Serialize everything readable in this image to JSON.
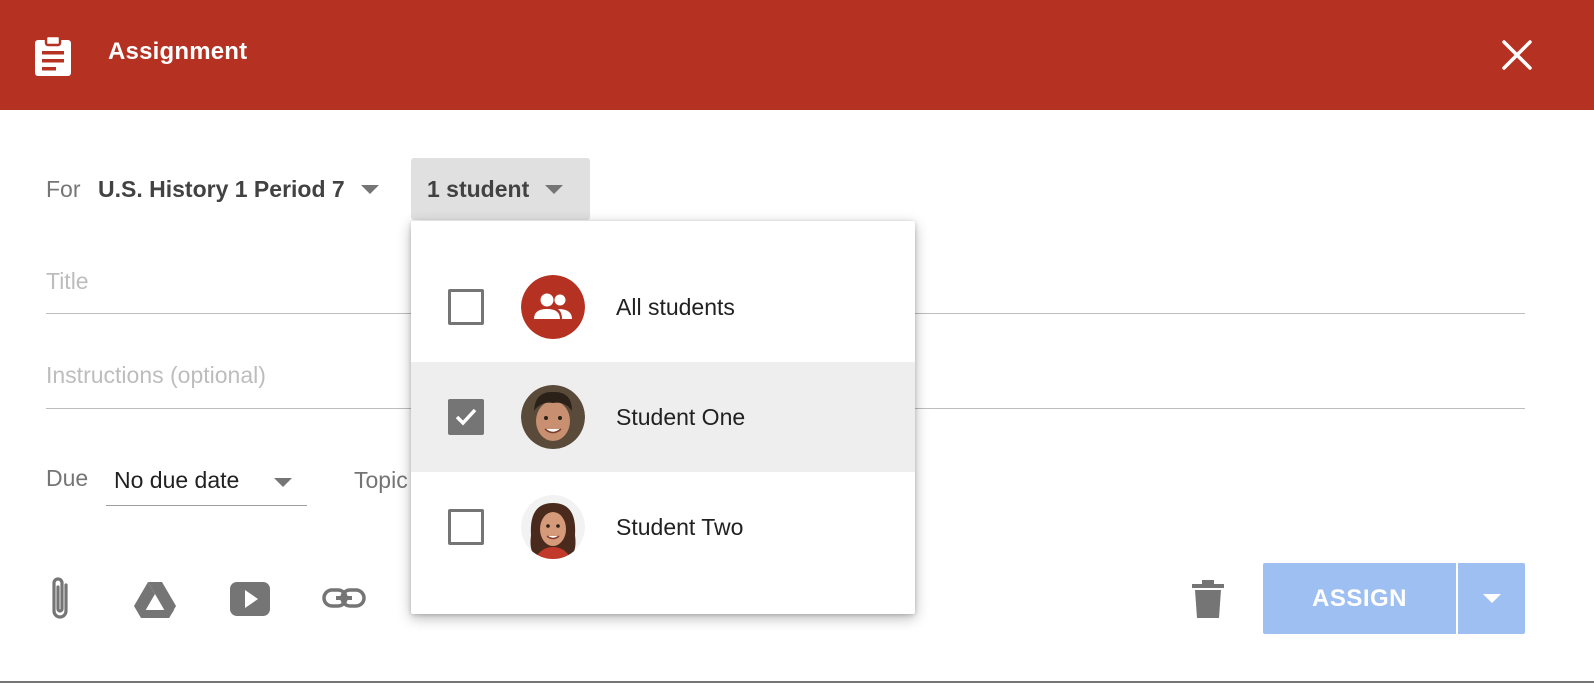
{
  "header": {
    "title": "Assignment",
    "icon": "assignment-clipboard-icon",
    "close_icon": "close-icon",
    "bg_color": "#b53122"
  },
  "form": {
    "for_label": "For",
    "class_name": "U.S. History 1 Period 7",
    "students_button": "1 student",
    "title_placeholder": "Title",
    "instructions_placeholder": "Instructions (optional)",
    "due_label": "Due",
    "due_value": "No due date",
    "topic_label": "Topic"
  },
  "student_dropdown": {
    "items": [
      {
        "label": "All students",
        "checked": false,
        "avatar": "group-icon"
      },
      {
        "label": "Student One",
        "checked": true,
        "avatar": "student-one-photo"
      },
      {
        "label": "Student Two",
        "checked": false,
        "avatar": "student-two-photo"
      }
    ]
  },
  "toolbar": {
    "icons": [
      "paperclip-icon",
      "google-drive-icon",
      "youtube-icon",
      "link-icon"
    ],
    "delete_icon": "trash-icon",
    "assign_label": "ASSIGN",
    "assign_color": "#9ebff2"
  }
}
